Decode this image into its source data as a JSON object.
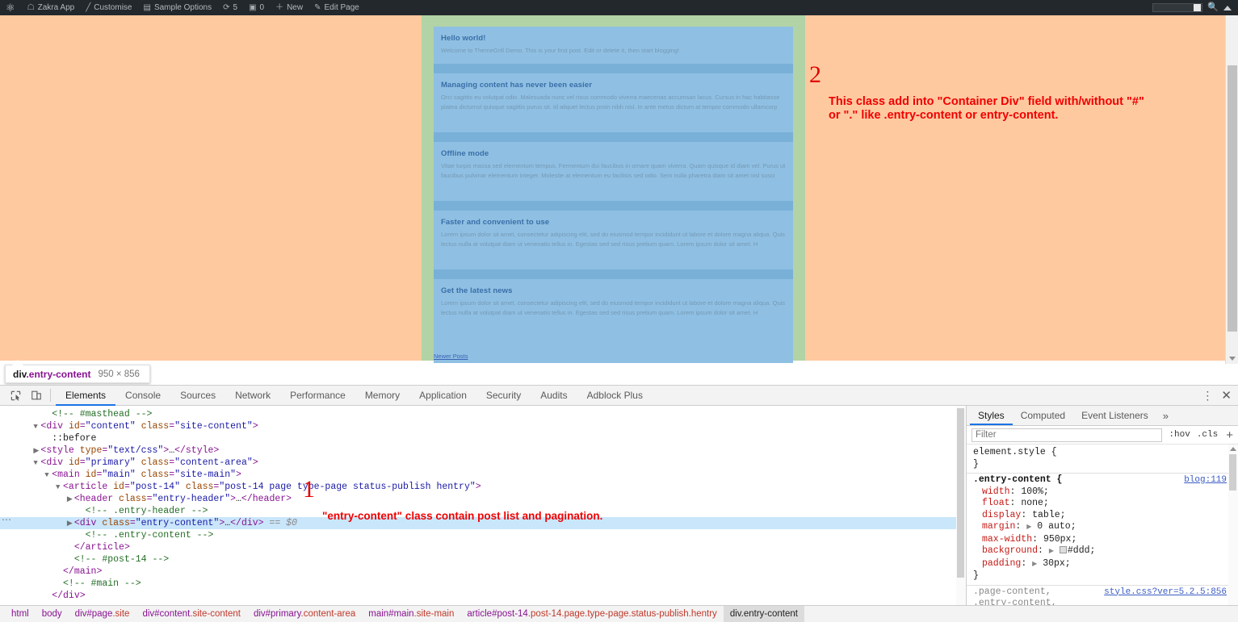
{
  "adminbar": {
    "wp_logo": "wordpress-logo-icon",
    "items": [
      {
        "icon": "home-icon",
        "glyph": "⌂",
        "label": "Zakra App"
      },
      {
        "icon": "paintbrush-icon",
        "glyph": "╱",
        "label": "Customise"
      },
      {
        "icon": "briefcase-icon",
        "glyph": "▤",
        "label": "Sample Options"
      },
      {
        "icon": "refresh-icon",
        "glyph": "⟳",
        "label": "5"
      },
      {
        "icon": "comment-icon",
        "glyph": "▣",
        "label": "0"
      },
      {
        "icon": "plus-icon",
        "glyph": "＋",
        "label": "New"
      },
      {
        "icon": "pencil-icon",
        "glyph": "✐",
        "label": "Edit Page"
      }
    ],
    "search_value": "",
    "search_icon": "magnifier-icon",
    "collapse_icon": "caret-up-icon"
  },
  "page": {
    "posts": [
      {
        "title": "Hello world!",
        "excerpt": "Welcome to ThemeGrill Demo. This is your first post. Edit or delete it, then start blogging!"
      },
      {
        "title": "Managing content has never been easier",
        "excerpt": "Orci sagittis eu volutpat odio. Malesuada nunc vel risus commodo viverra maecenas accumsan lacus. Cursus in hac habitasse platea dictumst quisque sagittis purus sit. Id aliquet lectus proin nibh nisl. In ante metus dictum at tempor commodo ullamcorp"
      },
      {
        "title": "Offline mode",
        "excerpt": "Vitae turpis massa sed elementum tempus. Fermentum dui faucibus in ornare quam viverra. Quam quisque id diam vel. Purus ut faucibus pulvinar elementum integer. Molestie at elementum eu facilisis sed odio. Sem nulla pharetra diam sit amet nisl susci"
      },
      {
        "title": "Faster and convenient to use",
        "excerpt": "Lorem ipsum dolor sit amet, consectetur adipiscing elit, sed do eiusmod tempor incididunt ut labore et dolore magna aliqua. Quis lectus nulla at volutpat diam ut venenatis tellus in. Egestas sed sed risus pretium quam. Lorem ipsum dolor sit amet. H"
      },
      {
        "title": "Get the latest news",
        "excerpt": "Lorem ipsum dolor sit amet, consectetur adipiscing elit, sed do eiusmod tempor incididunt ut labore et dolore magna aliqua. Quis lectus nulla at volutpat diam ut venenatis tellus in. Egestas sed sed risus pretium quam. Lorem ipsum dolor sit amet. H"
      }
    ],
    "pagination_link": "Newer Posts"
  },
  "annotations": {
    "one": {
      "number": "1",
      "text": "\"entry-content\" class contain post list and pagination.",
      "color": "#f00000"
    },
    "two": {
      "number": "2",
      "line1": "This class add into \"Container Div\" field with/without \"#\"",
      "line2": "or \".\" like .entry-content or entry-content.",
      "color": "#f00000"
    }
  },
  "inspect_tooltip": {
    "tag_name": "div",
    "tag_class": ".entry-content",
    "dimensions": "950 × 856"
  },
  "devtools": {
    "inspect_icon": "inspect-cursor-icon",
    "device_icon": "device-toolbar-icon",
    "tabs": [
      "Elements",
      "Console",
      "Sources",
      "Network",
      "Performance",
      "Memory",
      "Application",
      "Security",
      "Audits",
      "Adblock Plus"
    ],
    "active_tab": "Elements",
    "kebab_icon": "more-options-icon",
    "close_icon": "close-icon",
    "dom_lines": [
      {
        "indent": 3,
        "twisty": "",
        "parts": [
          [
            "com",
            "<!-- #masthead -->"
          ]
        ]
      },
      {
        "indent": 2,
        "twisty": "▼",
        "parts": [
          [
            "punc",
            "<"
          ],
          [
            "tag",
            "div"
          ],
          [
            "attr",
            " id"
          ],
          [
            "punc",
            "="
          ],
          [
            "val",
            "\"content\""
          ],
          [
            "attr",
            " class"
          ],
          [
            "punc",
            "="
          ],
          [
            "val",
            "\"site-content\""
          ],
          [
            "punc",
            ">"
          ]
        ]
      },
      {
        "indent": 3,
        "twisty": "",
        "parts": [
          [
            "txt",
            "::before"
          ]
        ]
      },
      {
        "indent": 2,
        "twisty": "▶",
        "parts": [
          [
            "punc",
            "<"
          ],
          [
            "tag",
            "style"
          ],
          [
            "attr",
            " type"
          ],
          [
            "punc",
            "="
          ],
          [
            "val",
            "\"text/css\""
          ],
          [
            "punc",
            ">"
          ],
          [
            "txt",
            "…"
          ],
          [
            "punc",
            "</"
          ],
          [
            "tag",
            "style"
          ],
          [
            "punc",
            ">"
          ]
        ]
      },
      {
        "indent": 2,
        "twisty": "▼",
        "parts": [
          [
            "punc",
            "<"
          ],
          [
            "tag",
            "div"
          ],
          [
            "attr",
            " id"
          ],
          [
            "punc",
            "="
          ],
          [
            "val",
            "\"primary\""
          ],
          [
            "attr",
            " class"
          ],
          [
            "punc",
            "="
          ],
          [
            "val",
            "\"content-area\""
          ],
          [
            "punc",
            ">"
          ]
        ]
      },
      {
        "indent": 3,
        "twisty": "▼",
        "parts": [
          [
            "punc",
            "<"
          ],
          [
            "tag",
            "main"
          ],
          [
            "attr",
            " id"
          ],
          [
            "punc",
            "="
          ],
          [
            "val",
            "\"main\""
          ],
          [
            "attr",
            " class"
          ],
          [
            "punc",
            "="
          ],
          [
            "val",
            "\"site-main\""
          ],
          [
            "punc",
            ">"
          ]
        ]
      },
      {
        "indent": 4,
        "twisty": "▼",
        "parts": [
          [
            "punc",
            "<"
          ],
          [
            "tag",
            "article"
          ],
          [
            "attr",
            " id"
          ],
          [
            "punc",
            "="
          ],
          [
            "val",
            "\"post-14\""
          ],
          [
            "attr",
            " class"
          ],
          [
            "punc",
            "="
          ],
          [
            "val",
            "\"post-14 page type-page status-publish hentry\""
          ],
          [
            "punc",
            ">"
          ]
        ]
      },
      {
        "indent": 5,
        "twisty": "▶",
        "parts": [
          [
            "punc",
            "<"
          ],
          [
            "tag",
            "header"
          ],
          [
            "attr",
            " class"
          ],
          [
            "punc",
            "="
          ],
          [
            "val",
            "\"entry-header\""
          ],
          [
            "punc",
            ">"
          ],
          [
            "txt",
            "…"
          ],
          [
            "punc",
            "</"
          ],
          [
            "tag",
            "header"
          ],
          [
            "punc",
            ">"
          ]
        ]
      },
      {
        "indent": 6,
        "twisty": "",
        "parts": [
          [
            "com",
            "<!-- .entry-header -->"
          ]
        ]
      },
      {
        "indent": 5,
        "twisty": "▶",
        "parts": [
          [
            "punc",
            "<"
          ],
          [
            "tag",
            "div"
          ],
          [
            "attr",
            " class"
          ],
          [
            "punc",
            "="
          ],
          [
            "val",
            "\"entry-content\""
          ],
          [
            "punc",
            ">"
          ],
          [
            "txt",
            "…"
          ],
          [
            "punc",
            "</"
          ],
          [
            "tag",
            "div"
          ],
          [
            "punc",
            ">"
          ],
          [
            "dollar",
            " == $0"
          ]
        ],
        "selected": true,
        "dots": true
      },
      {
        "indent": 6,
        "twisty": "",
        "parts": [
          [
            "com",
            "<!-- .entry-content -->"
          ]
        ]
      },
      {
        "indent": 5,
        "twisty": "",
        "parts": [
          [
            "punc",
            "</"
          ],
          [
            "tag",
            "article"
          ],
          [
            "punc",
            ">"
          ]
        ]
      },
      {
        "indent": 5,
        "twisty": "",
        "parts": [
          [
            "com",
            "<!-- #post-14 -->"
          ]
        ]
      },
      {
        "indent": 4,
        "twisty": "",
        "parts": [
          [
            "punc",
            "</"
          ],
          [
            "tag",
            "main"
          ],
          [
            "punc",
            ">"
          ]
        ]
      },
      {
        "indent": 4,
        "twisty": "",
        "parts": [
          [
            "com",
            "<!-- #main -->"
          ]
        ]
      },
      {
        "indent": 3,
        "twisty": "",
        "parts": [
          [
            "punc",
            "</"
          ],
          [
            "tag",
            "div"
          ],
          [
            "punc",
            ">"
          ]
        ]
      }
    ],
    "styles": {
      "tabs": [
        "Styles",
        "Computed",
        "Event Listeners"
      ],
      "active_tab": "Styles",
      "more_icon": "chevron-double-right-icon",
      "filter_placeholder": "Filter",
      "filter_value": "",
      "hov_label": ":hov",
      "cls_label": ".cls",
      "new_rule_label": "+",
      "rules": [
        {
          "selector": "element.style {",
          "source": "",
          "declarations": [],
          "close": "}"
        },
        {
          "selector": ".entry-content {",
          "source": "blog:119",
          "declarations": [
            {
              "prop": "width",
              "value": "100%;"
            },
            {
              "prop": "float",
              "value": "none;"
            },
            {
              "prop": "display",
              "value": "table;"
            },
            {
              "prop": "margin",
              "value": "0 auto;",
              "expand": true
            },
            {
              "prop": "max-width",
              "value": "950px;"
            },
            {
              "prop": "background",
              "value": "#ddd;",
              "expand": true,
              "swatch": "#dddddd"
            },
            {
              "prop": "padding",
              "value": "30px;",
              "expand": true
            }
          ],
          "close": "}"
        },
        {
          "selector": ".page-content,\n.entry-content,\n.entry-summary {",
          "source": "style.css?ver=5.2.5:856",
          "declarations": [],
          "close": ""
        }
      ]
    },
    "breadcrumbs": [
      {
        "tag": "html",
        "cls": ""
      },
      {
        "tag": "body",
        "cls": ""
      },
      {
        "tag": "div#page",
        "cls": ".site"
      },
      {
        "tag": "div#content",
        "cls": ".site-content"
      },
      {
        "tag": "div#primary",
        "cls": ".content-area"
      },
      {
        "tag": "main#main",
        "cls": ".site-main"
      },
      {
        "tag": "article#post-14",
        "cls": ".post-14.page.type-page.status-publish.hentry"
      },
      {
        "tag": "div.entry-content",
        "cls": "",
        "selected": true
      }
    ]
  }
}
